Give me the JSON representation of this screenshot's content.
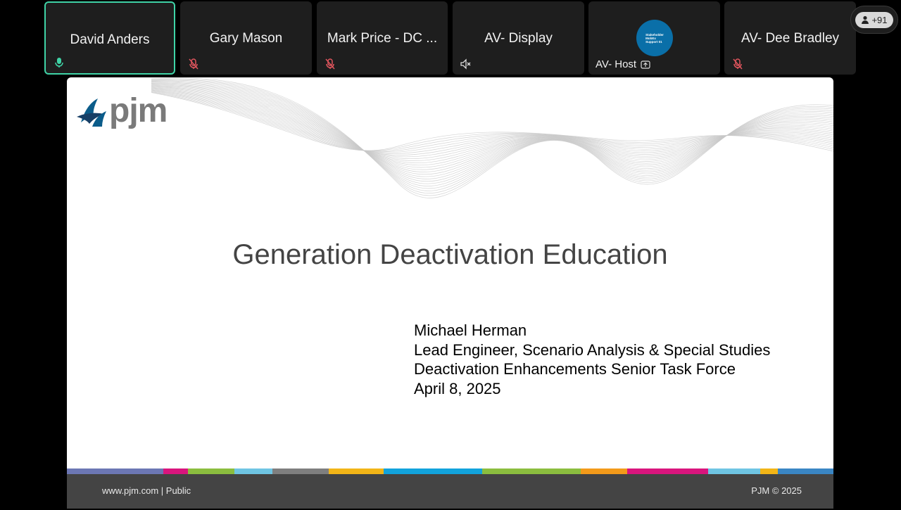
{
  "participants": [
    {
      "name": "David Anders",
      "status_icon": "microphone-active-icon",
      "active": true
    },
    {
      "name": "Gary Mason",
      "status_icon": "microphone-muted-icon"
    },
    {
      "name": "Mark Price - DC ...",
      "status_icon": "microphone-muted-icon"
    },
    {
      "name": "AV- Display",
      "status_icon": "speaker-muted-icon"
    },
    {
      "name": "",
      "avatar_text": "Stakeholder\nMobEx\nSupport 01",
      "host_label": "AV- Host",
      "status_icon": "share-screen-icon"
    },
    {
      "name": "AV- Dee Bradley",
      "status_icon": "microphone-muted-icon"
    }
  ],
  "overflow": {
    "count": "+91",
    "icon": "person-icon"
  },
  "slide": {
    "logo_text": "pjm",
    "title": "Generation Deactivation Education",
    "presenter_lines": [
      "Michael Herman",
      "Lead Engineer, Scenario Analysis & Special Studies",
      "Deactivation Enhancements Senior Task Force",
      "April 8, 2025"
    ],
    "footer_left": "www.pjm.com | Public",
    "footer_right": "PJM © 2025",
    "colorbar_colors": [
      "#6c77b4",
      "#d9157d",
      "#8bbd3f",
      "#6fc5e3",
      "#7f7f7f",
      "#f2b517",
      "#12a3dc",
      "#8bbd3f",
      "#f39a1a",
      "#d9157d",
      "#6fc5e3",
      "#f2b517",
      "#3a86c4"
    ]
  },
  "colors": {
    "active_border": "#3fd3a6",
    "muted_icon": "#e0555d",
    "tile_bg": "#1e1e1e"
  }
}
